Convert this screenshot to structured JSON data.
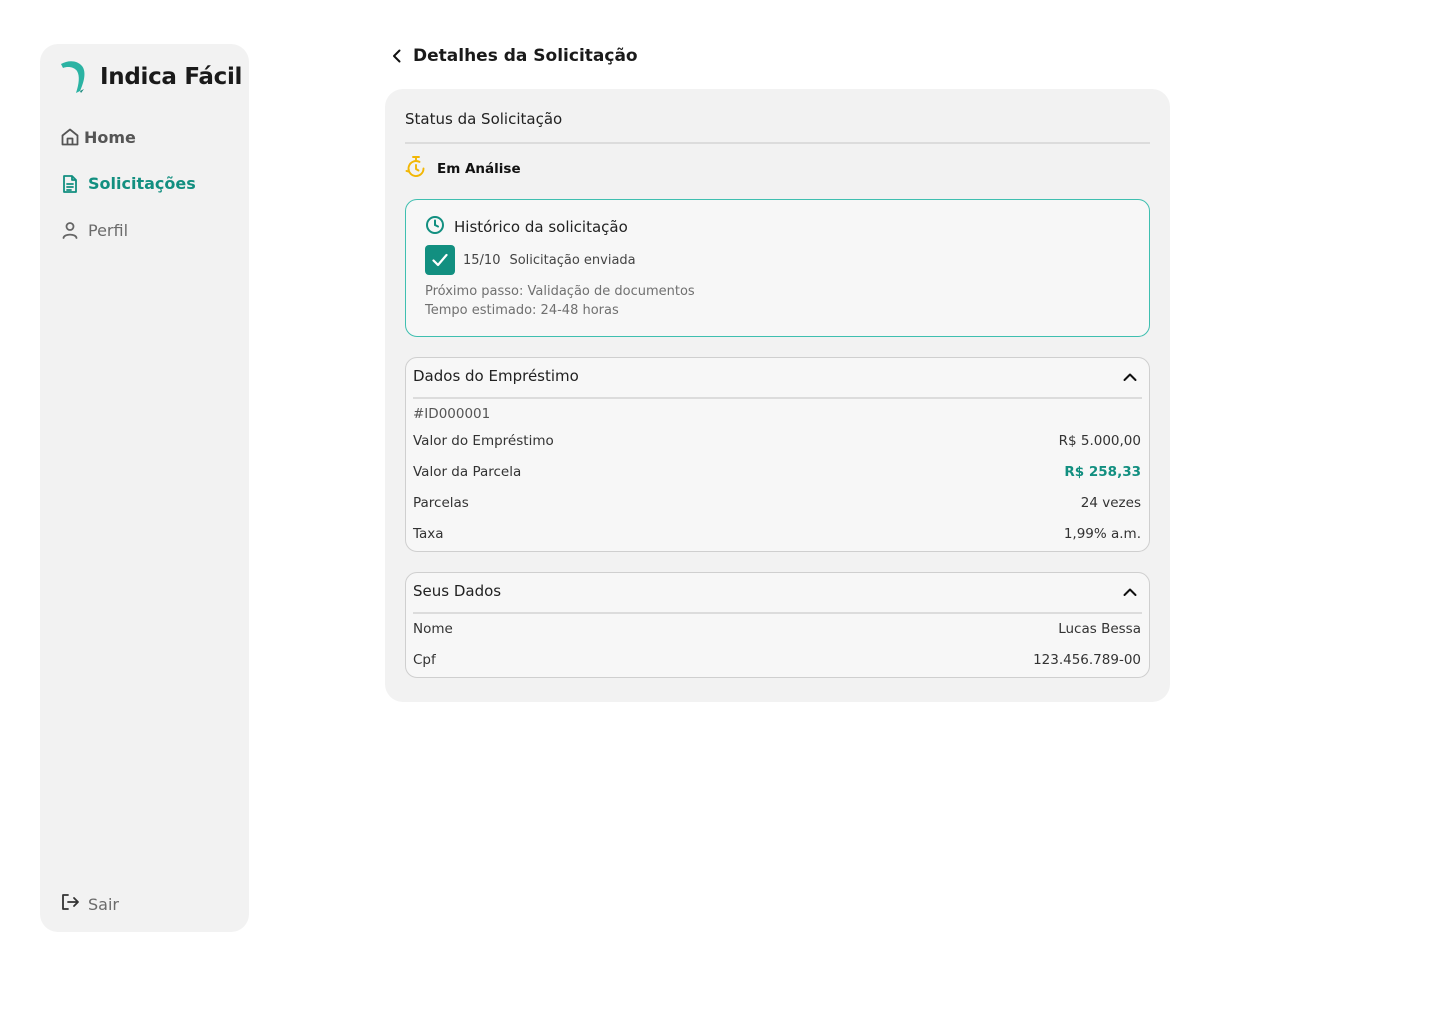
{
  "brand": {
    "name": "Indica Fácil",
    "accent": "#128f80",
    "warning": "#f2b705"
  },
  "sidebar": {
    "items": [
      {
        "label": "Home",
        "icon": "home-icon"
      },
      {
        "label": "Solicitações",
        "icon": "document-icon"
      },
      {
        "label": "Perfil",
        "icon": "user-icon"
      }
    ],
    "logout_label": "Sair"
  },
  "header": {
    "title": "Detalhes da Solicitação"
  },
  "status": {
    "title": "Status da Solicitação",
    "value": "Em Análise"
  },
  "history": {
    "title": "Histórico da solicitação",
    "items": [
      {
        "date": "15/10",
        "description": "Solicitação enviada",
        "checked": true
      }
    ],
    "next_step": "Próximo passo: Validação de documentos",
    "eta": "Tempo estimado: 24-48 horas"
  },
  "loan": {
    "title": "Dados do Empréstimo",
    "id": "#ID000001",
    "rows": [
      {
        "key": "Valor do Empréstimo",
        "value": "R$ 5.000,00"
      },
      {
        "key": "Valor da Parcela",
        "value": "R$ 258,33"
      },
      {
        "key": "Parcelas",
        "value": "24 vezes"
      },
      {
        "key": "Taxa",
        "value": "1,99% a.m."
      }
    ]
  },
  "user": {
    "title": "Seus Dados",
    "rows": [
      {
        "key": "Nome",
        "value": "Lucas Bessa"
      },
      {
        "key": "Cpf",
        "value": "123.456.789-00"
      }
    ]
  }
}
